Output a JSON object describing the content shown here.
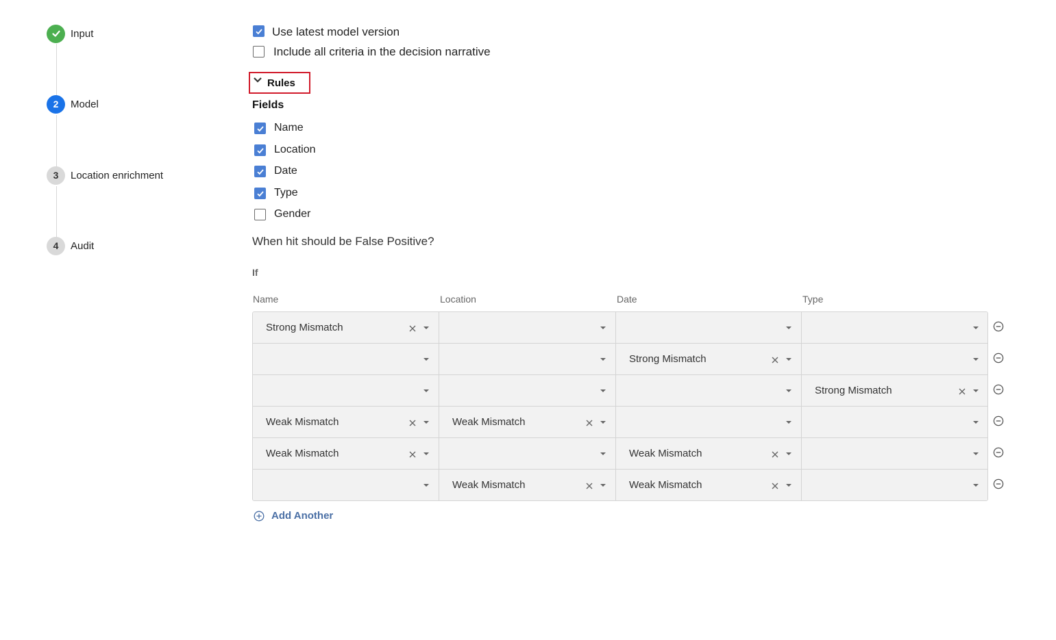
{
  "stepper": {
    "steps": [
      {
        "number": "",
        "label": "Input",
        "state": "done"
      },
      {
        "number": "2",
        "label": "Model",
        "state": "active"
      },
      {
        "number": "3",
        "label": "Location enrichment",
        "state": "todo"
      },
      {
        "number": "4",
        "label": "Audit",
        "state": "todo"
      }
    ]
  },
  "options": {
    "latest_model": {
      "label": "Use latest model version",
      "checked": true
    },
    "all_criteria": {
      "label": "Include all criteria in the decision narrative",
      "checked": false
    }
  },
  "rules": {
    "toggle_label": "Rules",
    "fields_heading": "Fields",
    "fields": [
      {
        "label": "Name",
        "checked": true
      },
      {
        "label": "Location",
        "checked": true
      },
      {
        "label": "Date",
        "checked": true
      },
      {
        "label": "Type",
        "checked": true
      },
      {
        "label": "Gender",
        "checked": false
      }
    ],
    "question": "When hit should be False Positive?",
    "if_label": "If",
    "columns": [
      "Name",
      "Location",
      "Date",
      "Type"
    ],
    "rows": [
      [
        "Strong Mismatch",
        "",
        "",
        ""
      ],
      [
        "",
        "",
        "Strong Mismatch",
        ""
      ],
      [
        "",
        "",
        "",
        "Strong Mismatch"
      ],
      [
        "Weak Mismatch",
        "Weak Mismatch",
        "",
        ""
      ],
      [
        "Weak Mismatch",
        "",
        "Weak Mismatch",
        ""
      ],
      [
        "",
        "Weak Mismatch",
        "Weak Mismatch",
        ""
      ]
    ],
    "add_another_label": "Add Another"
  },
  "colors": {
    "accent": "#1a73e8",
    "done": "#4caf50",
    "checkbox": "#4a7fd4",
    "highlight_border": "#d11a2a",
    "link": "#4a6fa5"
  }
}
